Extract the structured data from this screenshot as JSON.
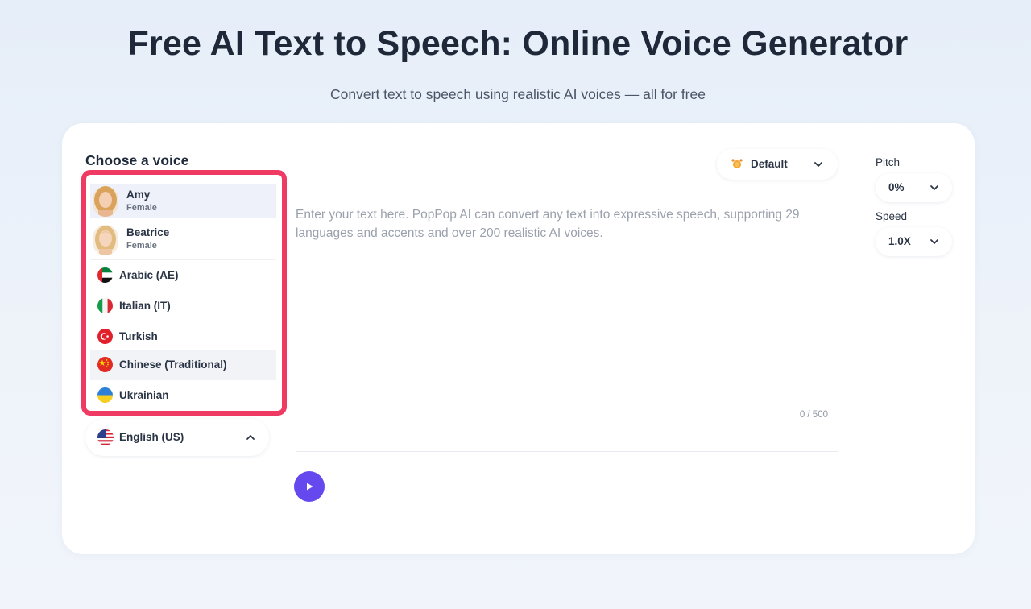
{
  "header": {
    "title": "Free AI Text to Speech: Online Voice Generator",
    "subtitle": "Convert text to speech using realistic AI voices — all for free"
  },
  "voice_panel": {
    "heading": "Choose a voice",
    "voices": [
      {
        "name": "Amy",
        "gender": "Female"
      },
      {
        "name": "Beatrice",
        "gender": "Female"
      }
    ],
    "languages": [
      {
        "name": "Arabic (AE)",
        "flag": "flag-uae-icon"
      },
      {
        "name": "Italian (IT)",
        "flag": "flag-italy-icon"
      },
      {
        "name": "Turkish",
        "flag": "flag-turkey-icon"
      },
      {
        "name": "Chinese (Traditional)",
        "flag": "flag-china-icon"
      },
      {
        "name": "Ukrainian",
        "flag": "flag-ukraine-icon"
      }
    ],
    "selected_language": "English (US)",
    "highlight_color": "#ef3a63"
  },
  "editor": {
    "placeholder": "Enter your text here. PopPop AI can convert any text into expressive speech, supporting 29 languages and accents and over 200 realistic AI voices.",
    "char_count": "0 / 500",
    "style_label": "Default",
    "play_icon": "play-icon",
    "accent_color": "#6549ee"
  },
  "settings": {
    "pitch_label": "Pitch",
    "pitch_value": "0%",
    "speed_label": "Speed",
    "speed_value": "1.0X"
  }
}
